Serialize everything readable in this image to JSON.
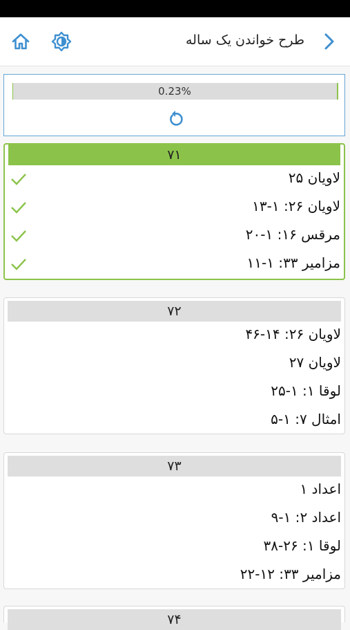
{
  "header": {
    "title": "طرح خواندن یک ساله"
  },
  "progress": {
    "label": "0.23%",
    "fraction": 0.0023
  },
  "colors": {
    "accent": "#3e8fd0",
    "done": "#8bc34a"
  },
  "days": [
    {
      "number": "۷۱",
      "completed": true,
      "readings": [
        "لاویان ۲۵",
        "لاویان ۲۶: ۱-۱۳",
        "مرقس ۱۶: ۱-۲۰",
        "مزامیر ۳۳: ۱-۱۱"
      ]
    },
    {
      "number": "۷۲",
      "completed": false,
      "readings": [
        "لاویان ۲۶: ۱۴-۴۶",
        "لاویان ۲۷",
        "لوقا ۱: ۱-۲۵",
        "امثال ۷: ۱-۵"
      ]
    },
    {
      "number": "۷۳",
      "completed": false,
      "readings": [
        "اعداد ۱",
        "اعداد ۲: ۱-۹",
        "لوقا ۱: ۲۶-۳۸",
        "مزامیر ۳۳: ۱۲-۲۲"
      ]
    },
    {
      "number": "۷۴",
      "completed": false,
      "readings": []
    }
  ]
}
